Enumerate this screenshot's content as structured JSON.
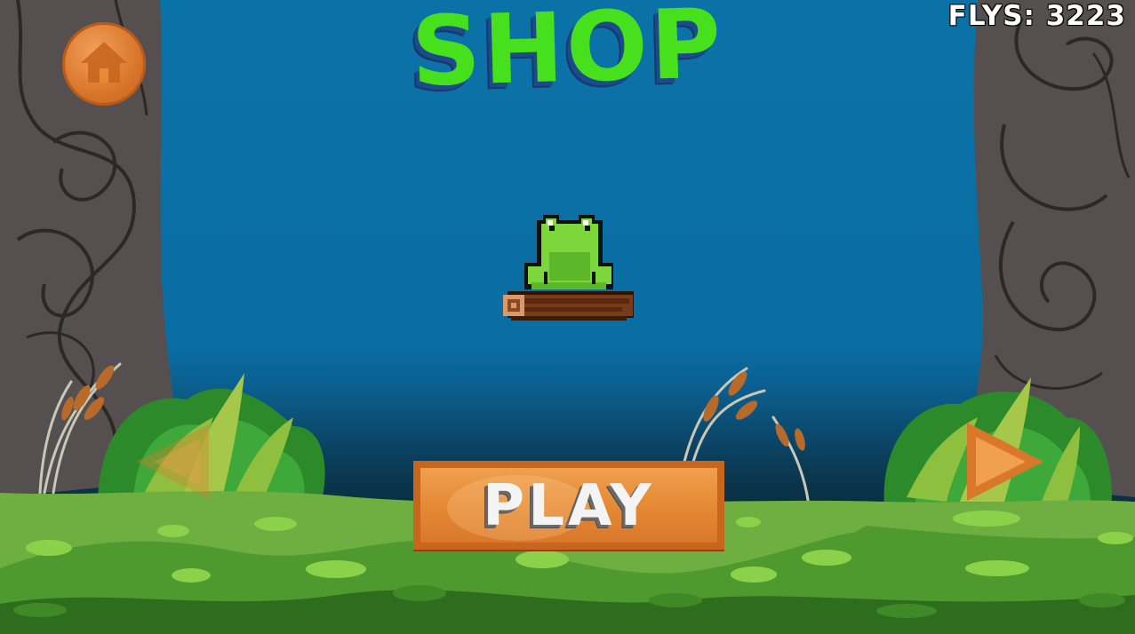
{
  "title": "SHOP",
  "counter": {
    "text": "FLYS: 3223"
  },
  "buttons": {
    "play": "PLAY"
  },
  "icons": {
    "home": "home-icon",
    "prev": "left-arrow-icon",
    "next": "right-arrow-icon"
  },
  "colors": {
    "title": "#46e01c",
    "wood": "#e58a36",
    "sky": "#0b72a8",
    "grass": "#4e9a2e"
  }
}
